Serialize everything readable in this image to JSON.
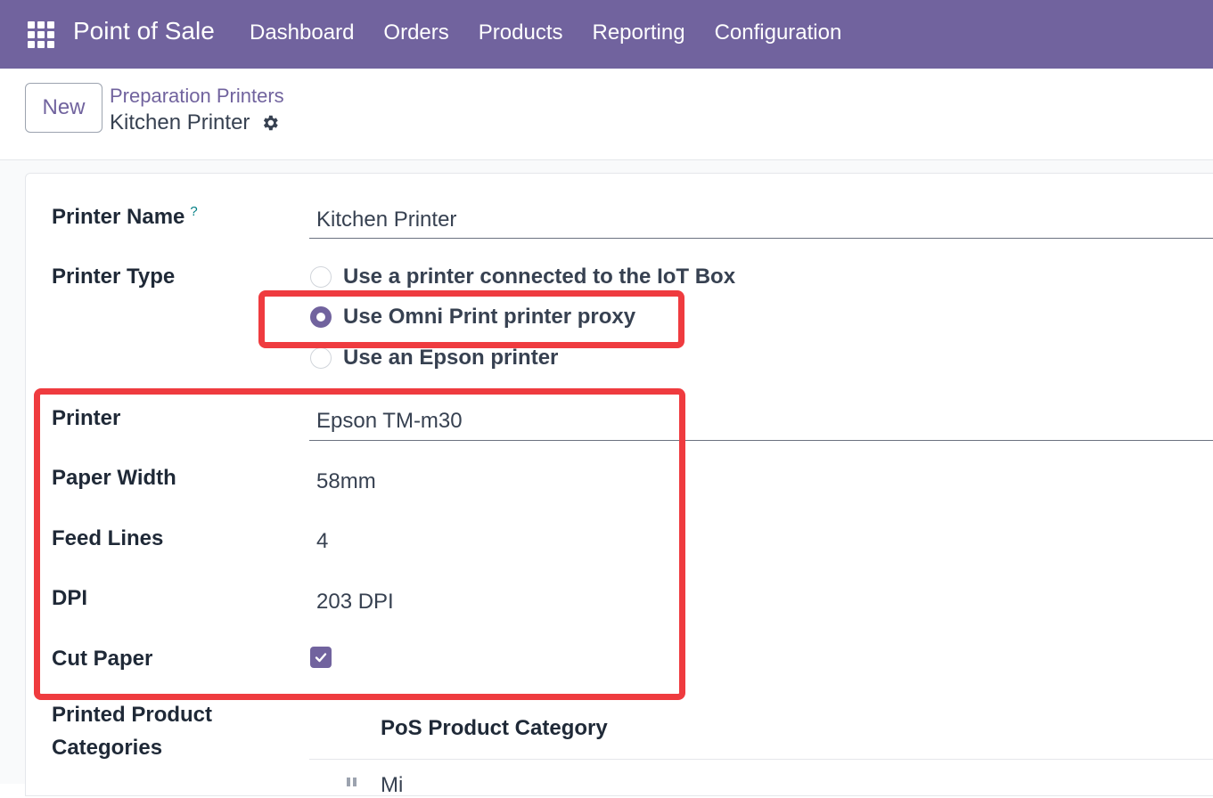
{
  "navbar": {
    "app_name": "Point of Sale",
    "menu": [
      "Dashboard",
      "Orders",
      "Products",
      "Reporting",
      "Configuration"
    ],
    "apps_icon": "grid-icon"
  },
  "control_panel": {
    "new_label": "New",
    "breadcrumb_parent": "Preparation Printers",
    "breadcrumb_current": "Kitchen Printer",
    "settings_icon": "gear-icon"
  },
  "form": {
    "printer_name_label": "Printer Name",
    "printer_name_help": "?",
    "printer_name_value": "Kitchen Printer",
    "printer_type_label": "Printer Type",
    "printer_type_options": [
      {
        "label": "Use a printer connected to the IoT Box",
        "selected": false
      },
      {
        "label": "Use Omni Print printer proxy",
        "selected": true
      },
      {
        "label": "Use an Epson printer",
        "selected": false
      }
    ],
    "printer_label": "Printer",
    "printer_value": "Epson TM-m30",
    "paper_width_label": "Paper Width",
    "paper_width_value": "58mm",
    "feed_lines_label": "Feed Lines",
    "feed_lines_value": "4",
    "dpi_label": "DPI",
    "dpi_value": "203 DPI",
    "cut_paper_label": "Cut Paper",
    "cut_paper_checked": true,
    "categories_label_line1": "Printed Product",
    "categories_label_line2": "Categories",
    "categories_column_header": "PoS Product Category",
    "categories_first_row_peek": "Mi"
  },
  "colors": {
    "brand": "#71639e",
    "highlight": "#ef3b3f"
  }
}
